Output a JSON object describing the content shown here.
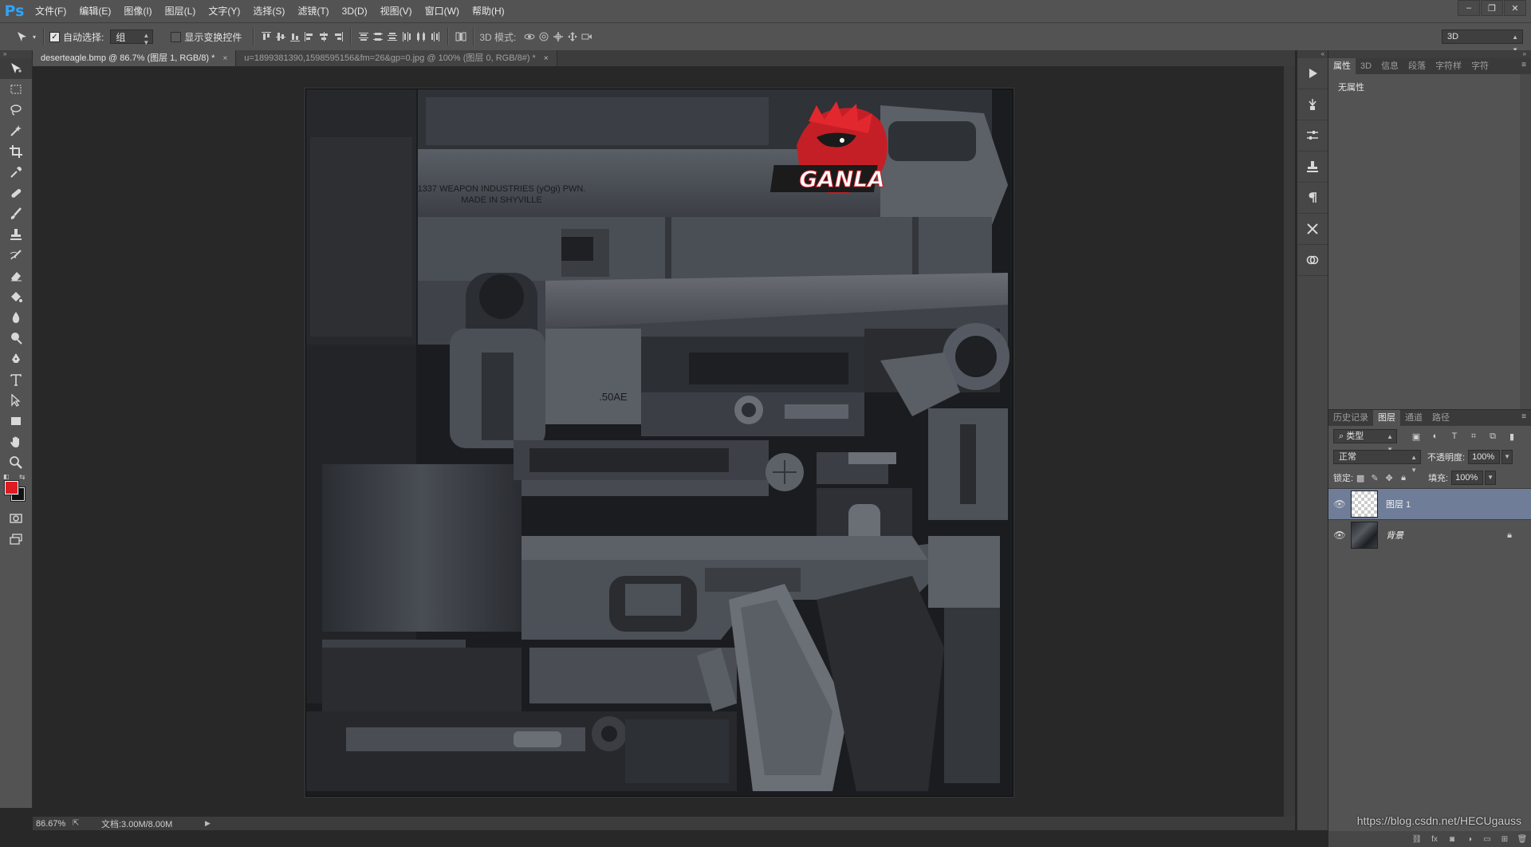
{
  "app": {
    "logo": "Ps"
  },
  "menu": [
    "文件(F)",
    "编辑(E)",
    "图像(I)",
    "图层(L)",
    "文字(Y)",
    "选择(S)",
    "滤镜(T)",
    "3D(D)",
    "视图(V)",
    "窗口(W)",
    "帮助(H)"
  ],
  "options": {
    "auto_select_label": "自动选择:",
    "auto_select_value": "组",
    "show_transform_label": "显示变换控件",
    "mode_3d_label": "3D 模式:",
    "workspace": "3D"
  },
  "tabs": [
    {
      "label": "deserteagle.bmp @ 86.7% (图层 1, RGB/8) *",
      "close": "×"
    },
    {
      "label": "u=1899381390,1598595156&fm=26&gp=0.jpg @ 100% (图层 0, RGB/8#) *",
      "close": "×"
    }
  ],
  "canvas": {
    "engraving_line1": "1337 WEAPON INDUSTRIES (yOgi) PWN.",
    "engraving_line2": "MADE IN SHYVILLE",
    "caliber": ".50AE",
    "logo_text": "GANLA",
    "colors": {
      "background": "#1c1c1c",
      "metal": "#4a4f56",
      "metal_dark": "#2d3036",
      "logo_red": "#d8242a"
    }
  },
  "status": {
    "zoom": "86.67%",
    "doc_size": "文档:3.00M/8.00M"
  },
  "properties_panel": {
    "tabs": [
      "属性",
      "3D",
      "信息",
      "段落",
      "字符样",
      "字符"
    ],
    "empty_text": "无属性"
  },
  "layers_panel": {
    "tabs": [
      "历史记录",
      "图层",
      "通道",
      "路径"
    ],
    "filter_kind": "类型",
    "blend_mode": "正常",
    "opacity_label": "不透明度:",
    "opacity_value": "100%",
    "lock_label": "锁定:",
    "fill_label": "填充:",
    "fill_value": "100%",
    "layers": [
      {
        "name": "图层 1",
        "selected": true
      },
      {
        "name": "背景",
        "locked": true
      }
    ]
  },
  "colors": {
    "foreground": "#e01a22",
    "background": "#111111"
  },
  "watermark": "https://blog.csdn.net/HECUgauss"
}
